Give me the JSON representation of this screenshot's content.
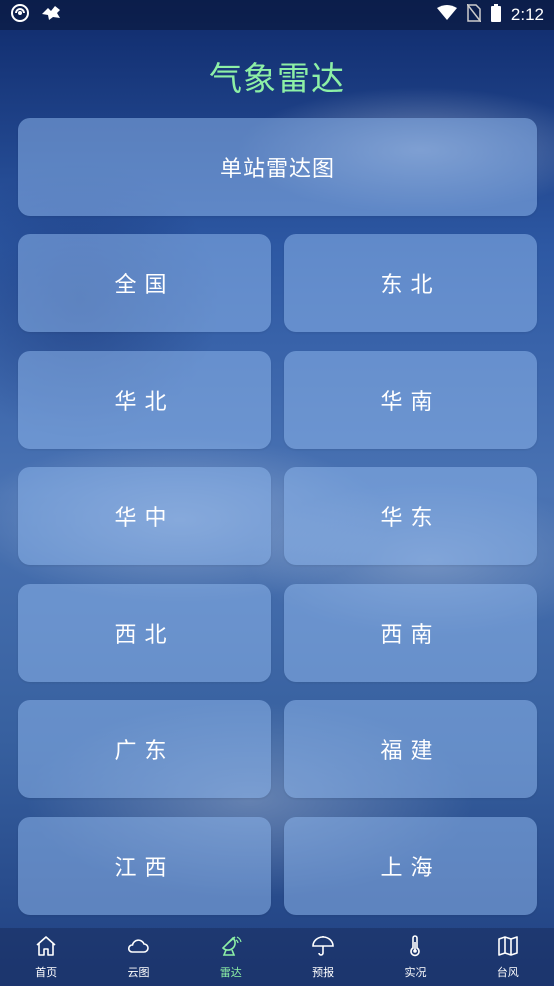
{
  "status_bar": {
    "time": "2:12",
    "icons": [
      "app-notification-icon",
      "bird-notification-icon",
      "wifi-icon",
      "no-sim-icon",
      "battery-icon"
    ]
  },
  "title": "气象雷达",
  "single_station": {
    "label": "单站雷达图"
  },
  "regions": [
    {
      "label": "全国"
    },
    {
      "label": "东北"
    },
    {
      "label": "华北"
    },
    {
      "label": "华南"
    },
    {
      "label": "华中"
    },
    {
      "label": "华东"
    },
    {
      "label": "西北"
    },
    {
      "label": "西南"
    },
    {
      "label": "广东"
    },
    {
      "label": "福建"
    },
    {
      "label": "江西"
    },
    {
      "label": "上海"
    }
  ],
  "bottom_nav": {
    "active_index": 2,
    "active_color": "#8df0a6",
    "items": [
      {
        "label": "首页",
        "icon": "home-icon"
      },
      {
        "label": "云图",
        "icon": "cloud-icon"
      },
      {
        "label": "雷达",
        "icon": "radar-icon"
      },
      {
        "label": "预报",
        "icon": "umbrella-icon"
      },
      {
        "label": "实况",
        "icon": "thermometer-icon"
      },
      {
        "label": "台风",
        "icon": "map-icon"
      }
    ]
  }
}
